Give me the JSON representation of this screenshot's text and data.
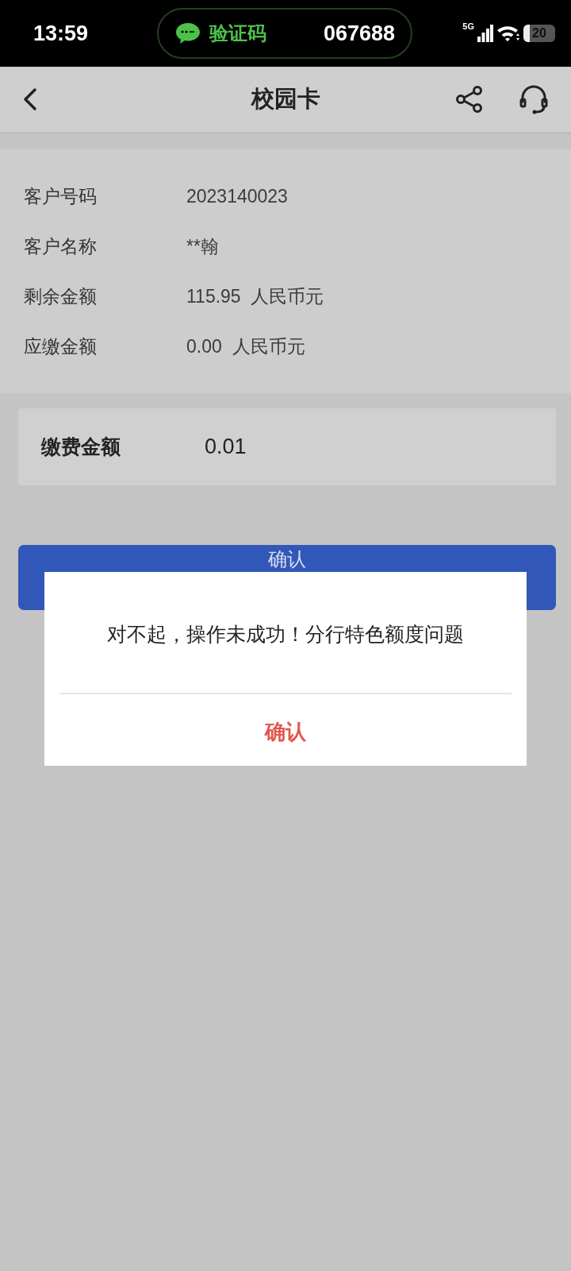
{
  "status_bar": {
    "time": "13:59",
    "notification": {
      "label": "验证码",
      "code": "067688"
    },
    "network": "5G",
    "battery": "20"
  },
  "header": {
    "title": "校园卡"
  },
  "account": [
    {
      "label": "客户号码",
      "value": "2023140023"
    },
    {
      "label": "客户名称",
      "value": "**翰"
    },
    {
      "label": "剩余金额",
      "value": "115.95  人民币元"
    },
    {
      "label": "应缴金额",
      "value": "0.00  人民币元"
    }
  ],
  "payment": {
    "label": "缴费金额",
    "value": "0.01"
  },
  "confirm_button": "确认",
  "dialog": {
    "message": "对不起，操作未成功！分行特色额度问题",
    "button": "确认"
  }
}
